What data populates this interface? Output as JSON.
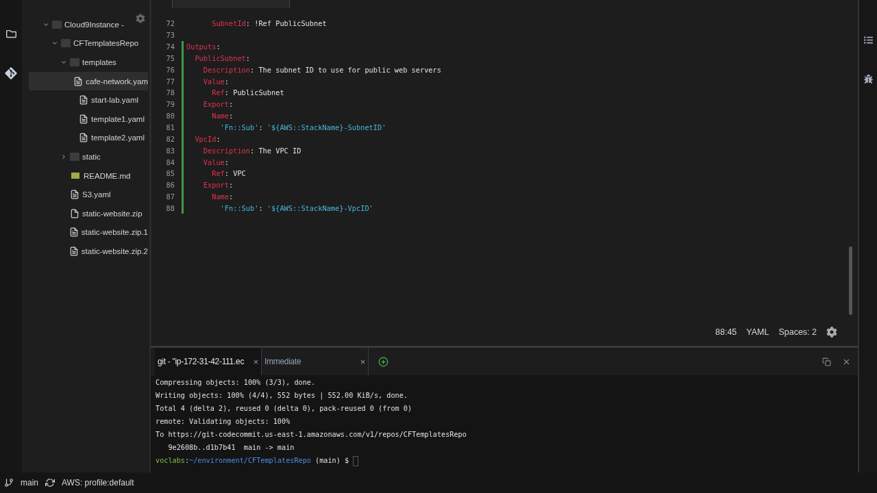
{
  "sidebar": {
    "tree": [
      {
        "name": "Cloud9Instance -",
        "kind": "folder",
        "expanded": true,
        "selected": false,
        "children": [
          {
            "name": "CFTemplatesRepo",
            "kind": "folder",
            "expanded": true,
            "selected": false,
            "children": [
              {
                "name": "templates",
                "kind": "folder",
                "expanded": true,
                "selected": false,
                "children": [
                  {
                    "name": "cafe-network.yam",
                    "kind": "file",
                    "selected": true
                  },
                  {
                    "name": "start-lab.yaml",
                    "kind": "file",
                    "selected": false
                  },
                  {
                    "name": "template1.yaml",
                    "kind": "file",
                    "selected": false
                  },
                  {
                    "name": "template2.yaml",
                    "kind": "file",
                    "selected": false
                  }
                ]
              },
              {
                "name": "static",
                "kind": "folder",
                "expanded": false,
                "selected": false
              },
              {
                "name": "README.md",
                "kind": "markdown",
                "selected": false
              },
              {
                "name": "S3.yaml",
                "kind": "file",
                "selected": false
              },
              {
                "name": "static-website.zip",
                "kind": "zip",
                "selected": false
              },
              {
                "name": "static-website.zip.1",
                "kind": "file",
                "selected": false
              },
              {
                "name": "static-website.zip.2",
                "kind": "file",
                "selected": false
              }
            ]
          }
        ]
      }
    ]
  },
  "editor": {
    "lines": [
      {
        "number": "72",
        "changed": false,
        "tokens": [
          {
            "kind": "key",
            "text": "      SubnetId"
          },
          {
            "kind": "plain",
            "text": ": !Ref PublicSubnet"
          }
        ]
      },
      {
        "number": "73",
        "changed": false
      },
      {
        "number": "74",
        "changed": true,
        "tokens": [
          {
            "kind": "key",
            "text": "Outputs"
          },
          {
            "kind": "plain",
            "text": ":"
          }
        ]
      },
      {
        "number": "75",
        "changed": true,
        "tokens": [
          {
            "kind": "key",
            "text": "  PublicSubnet"
          },
          {
            "kind": "plain",
            "text": ":"
          }
        ]
      },
      {
        "number": "76",
        "changed": true,
        "tokens": [
          {
            "kind": "key",
            "text": "    Description"
          },
          {
            "kind": "plain",
            "text": ": The subnet ID to use for public web servers"
          }
        ]
      },
      {
        "number": "77",
        "changed": true,
        "tokens": [
          {
            "kind": "key",
            "text": "    Value"
          },
          {
            "kind": "plain",
            "text": ":"
          }
        ]
      },
      {
        "number": "78",
        "changed": true,
        "tokens": [
          {
            "kind": "key",
            "text": "      Ref"
          },
          {
            "kind": "plain",
            "text": ": PublicSubnet"
          }
        ]
      },
      {
        "number": "79",
        "changed": true,
        "tokens": [
          {
            "kind": "key",
            "text": "    Export"
          },
          {
            "kind": "plain",
            "text": ":"
          }
        ]
      },
      {
        "number": "80",
        "changed": true,
        "tokens": [
          {
            "kind": "key",
            "text": "      Name"
          },
          {
            "kind": "plain",
            "text": ":"
          }
        ]
      },
      {
        "number": "81",
        "changed": true,
        "tokens": [
          {
            "kind": "string",
            "text": "        'Fn::Sub'"
          },
          {
            "kind": "plain",
            "text": ": "
          },
          {
            "kind": "string",
            "text": "'${AWS::StackName}-SubnetID'"
          }
        ]
      },
      {
        "number": "82",
        "changed": true,
        "tokens": [
          {
            "kind": "key",
            "text": "  VpcId"
          },
          {
            "kind": "plain",
            "text": ":"
          }
        ]
      },
      {
        "number": "83",
        "changed": true,
        "tokens": [
          {
            "kind": "key",
            "text": "    Description"
          },
          {
            "kind": "plain",
            "text": ": The VPC ID"
          }
        ]
      },
      {
        "number": "84",
        "changed": true,
        "tokens": [
          {
            "kind": "key",
            "text": "    Value"
          },
          {
            "kind": "plain",
            "text": ":"
          }
        ]
      },
      {
        "number": "85",
        "changed": true,
        "tokens": [
          {
            "kind": "key",
            "text": "      Ref"
          },
          {
            "kind": "plain",
            "text": ": VPC"
          }
        ]
      },
      {
        "number": "86",
        "changed": true,
        "tokens": [
          {
            "kind": "key",
            "text": "    Export"
          },
          {
            "kind": "plain",
            "text": ":"
          }
        ]
      },
      {
        "number": "87",
        "changed": true,
        "tokens": [
          {
            "kind": "key",
            "text": "      Name"
          },
          {
            "kind": "plain",
            "text": ":"
          }
        ]
      },
      {
        "number": "88",
        "changed": true,
        "tokens": [
          {
            "kind": "string",
            "text": "        'Fn::Sub'"
          },
          {
            "kind": "plain",
            "text": ": "
          },
          {
            "kind": "string",
            "text": "'${AWS::StackName}-VpcID'"
          }
        ]
      }
    ],
    "status": {
      "position": "88:45",
      "language": "YAML",
      "indent": "Spaces: 2"
    }
  },
  "terminal": {
    "tabs": [
      {
        "label": "git - \"ip-172-31-42-111.ec",
        "selected": true,
        "close": "×"
      },
      {
        "label": "Immediate",
        "selected": false,
        "close": "×"
      }
    ],
    "lines": [
      {
        "tokens": [
          {
            "kind": "plain",
            "text": "Compressing objects: 100% (3/3), done."
          }
        ]
      },
      {
        "tokens": [
          {
            "kind": "plain",
            "text": "Writing objects: 100% (4/4), 552 bytes | 552.00 KiB/s, done."
          }
        ]
      },
      {
        "tokens": [
          {
            "kind": "plain",
            "text": "Total 4 (delta 2), reused 0 (delta 0), pack-reused 0 (from 0)"
          }
        ]
      },
      {
        "tokens": [
          {
            "kind": "plain",
            "text": "remote: Validating objects: 100%"
          }
        ]
      },
      {
        "tokens": [
          {
            "kind": "plain",
            "text": "To https://git-codecommit.us-east-1.amazonaws.com/v1/repos/CFTemplatesRepo"
          }
        ]
      },
      {
        "tokens": [
          {
            "kind": "plain",
            "text": "   9e2608b..d1b7b41  main -> main"
          }
        ]
      },
      {
        "tokens": [
          {
            "kind": "user",
            "text": "voclabs"
          },
          {
            "kind": "plain",
            "text": ":"
          },
          {
            "kind": "path",
            "text": "~/environment/CFTemplatesRepo"
          },
          {
            "kind": "plain",
            "text": " (main) $ "
          }
        ]
      }
    ]
  },
  "status_bar": {
    "branch": "main",
    "profile": "AWS: profile:default"
  }
}
